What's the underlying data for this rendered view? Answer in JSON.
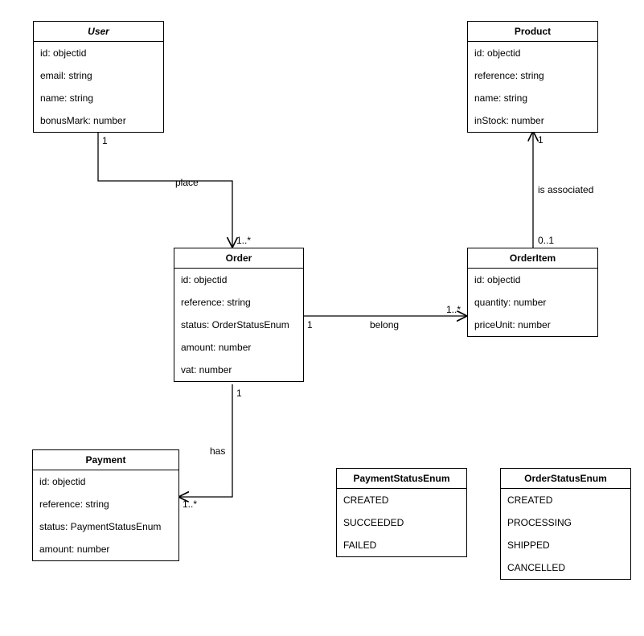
{
  "classes": {
    "user": {
      "title": "User",
      "attrs": [
        "id: objectid",
        "email: string",
        "name: string",
        "bonusMark: number"
      ]
    },
    "product": {
      "title": "Product",
      "attrs": [
        "id: objectid",
        "reference: string",
        "name: string",
        "inStock: number"
      ]
    },
    "order": {
      "title": "Order",
      "attrs": [
        "id: objectid",
        "reference: string",
        "status: OrderStatusEnum",
        "amount: number",
        "vat: number"
      ]
    },
    "orderItem": {
      "title": "OrderItem",
      "attrs": [
        "id: objectid",
        "quantity: number",
        "priceUnit: number"
      ]
    },
    "payment": {
      "title": "Payment",
      "attrs": [
        "id: objectid",
        "reference: string",
        "status: PaymentStatusEnum",
        "amount: number"
      ]
    },
    "paymentStatusEnum": {
      "title": "PaymentStatusEnum",
      "attrs": [
        "CREATED",
        "SUCCEEDED",
        "FAILED"
      ]
    },
    "orderStatusEnum": {
      "title": "OrderStatusEnum",
      "attrs": [
        "CREATED",
        "PROCESSING",
        "SHIPPED",
        "CANCELLED"
      ]
    }
  },
  "relations": {
    "place": {
      "label": "place",
      "fromMult": "1",
      "toMult": "1..*"
    },
    "belong": {
      "label": "belong",
      "fromMult": "1",
      "toMult": "1..*"
    },
    "isAssociated": {
      "label": "is associated",
      "fromMult": "0..1",
      "toMult": "1"
    },
    "has": {
      "label": "has",
      "fromMult": "1",
      "toMult": "1..*"
    }
  }
}
